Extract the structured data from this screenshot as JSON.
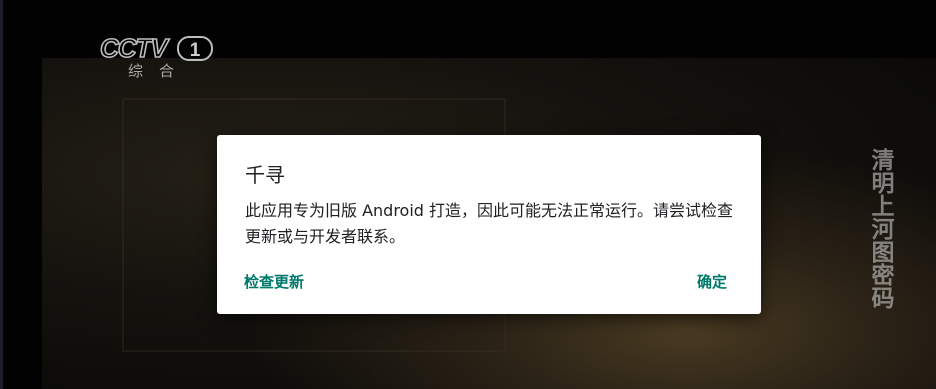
{
  "channel": {
    "logo_text": "CCTV",
    "number": "1",
    "name": "综合"
  },
  "program_title": [
    "清",
    "明",
    "上",
    "河",
    "图",
    "密",
    "码"
  ],
  "dialog": {
    "title": "千寻",
    "message": "此应用专为旧版 Android 打造，因此可能无法正常运行。请尝试检查更新或与开发者联系。",
    "check_update_button": "检查更新",
    "ok_button": "确定",
    "accent_color": "#00796b"
  }
}
